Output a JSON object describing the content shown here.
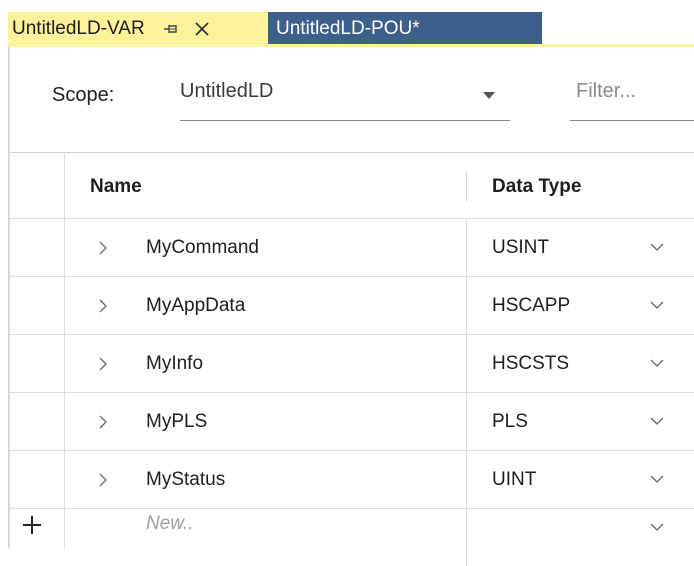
{
  "tabs": [
    {
      "label": "UntitledLD-VAR",
      "active": true,
      "pin_icon": "pin-icon",
      "close_icon": "close-icon"
    },
    {
      "label": "UntitledLD-POU*",
      "active": false
    }
  ],
  "scope": {
    "label": "Scope:",
    "value": "UntitledLD"
  },
  "filter": {
    "placeholder": "Filter..."
  },
  "grid": {
    "columns": [
      "Name",
      "Data Type"
    ],
    "rows": [
      {
        "name": "MyCommand",
        "type": "USINT"
      },
      {
        "name": "MyAppData",
        "type": "HSCAPP"
      },
      {
        "name": "MyInfo",
        "type": "HSCSTS"
      },
      {
        "name": "MyPLS",
        "type": "PLS"
      },
      {
        "name": "MyStatus",
        "type": "UINT"
      }
    ],
    "new_row_placeholder": "New.."
  },
  "colors": {
    "active_tab": "#fff29d",
    "inactive_tab": "#3c5f8c",
    "grid_line": "#dcdcdc"
  }
}
